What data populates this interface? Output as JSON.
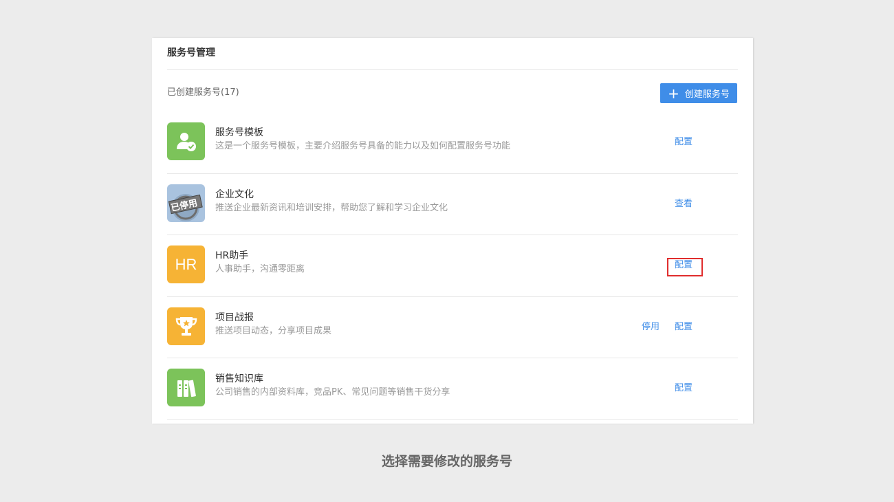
{
  "panel": {
    "title": "服务号管理",
    "count_label": "已创建服务号(17)",
    "create_button": {
      "icon": "plus-icon",
      "label": "创建服务号"
    }
  },
  "services": [
    {
      "name": "服务号模板",
      "desc": "这是一个服务号模板，主要介绍服务号具备的能力以及如何配置服务号功能",
      "icon": "user-check-icon",
      "icon_color": "#7cc35a",
      "actions": [
        "配置"
      ]
    },
    {
      "name": "企业文化",
      "desc": "推送企业最新资讯和培训安排，帮助您了解和学习企业文化",
      "icon": "disabled-stamp-icon",
      "icon_color": "#a9c3df",
      "stamp_text": "已停用",
      "actions": [
        "查看"
      ]
    },
    {
      "name": "HR助手",
      "desc": "人事助手，沟通零距离",
      "icon": "hr-icon",
      "icon_text": "HR",
      "icon_color": "#f6b335",
      "actions": [
        "配置"
      ],
      "highlighted": true
    },
    {
      "name": "项目战报",
      "desc": "推送项目动态，分享项目成果",
      "icon": "trophy-icon",
      "icon_color": "#f6b335",
      "actions": [
        "停用",
        "配置"
      ]
    },
    {
      "name": "销售知识库",
      "desc": "公司销售的内部资料库，竞品PK、常见问题等销售干货分享",
      "icon": "books-icon",
      "icon_color": "#7cc35a",
      "actions": [
        "配置"
      ]
    }
  ],
  "caption": "选择需要修改的服务号",
  "colors": {
    "accent": "#3f8de8",
    "highlight": "#e02d2d"
  }
}
